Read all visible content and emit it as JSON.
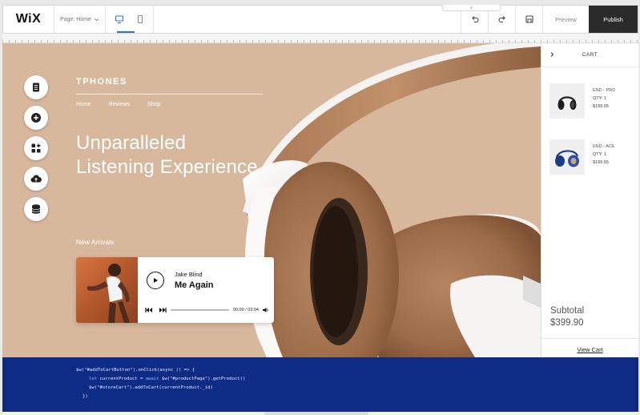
{
  "editor": {
    "logo": "WiX",
    "page_selector": "Page: Home",
    "preview_label": "Preview",
    "publish_label": "Publish",
    "handle_icon": "v"
  },
  "site": {
    "brand": "TPHONES",
    "nav": [
      "Home",
      "Reviews",
      "Shop"
    ],
    "headline_line1": "Unparalleled",
    "headline_line2": "Listening Experience",
    "section_label": "New Arrivals"
  },
  "player": {
    "artist": "Jake Blind",
    "track": "Me Again",
    "time": "00:00 / 03:04",
    "progress": 0.0
  },
  "cart": {
    "title": "CART",
    "items": [
      {
        "name": "END - PRO",
        "qty": "QTY: 1",
        "price": "$199.95"
      },
      {
        "name": "END - ACE",
        "qty": "QTY: 1",
        "price": "$199.95"
      }
    ],
    "subtotal_label": "Subtotal",
    "subtotal_value": "$399.90",
    "view_cart_label": "View Cart"
  },
  "code": {
    "line1": "$w(\"#addToCartButton\").onClick(async () => {",
    "line2_kw1": "let",
    "line2_mid": " currentProduct = ",
    "line2_kw2": "await",
    "line2_rest": " $w(\"#productPage\").getProduct()",
    "line3": "$w(\"#storeCart\").addToCart(currentProduct._id)",
    "line4": "})"
  },
  "colors": {
    "canvas_bg": "#d8b89d",
    "publish_bg": "#2b2b2b",
    "code_bg": "#0e2b86",
    "accent": "#2b6cf6"
  }
}
